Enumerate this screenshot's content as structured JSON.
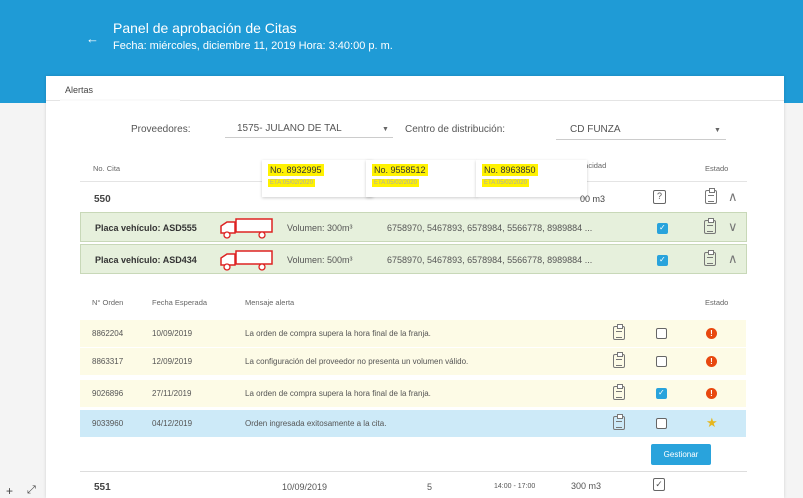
{
  "header": {
    "title": "Panel de aprobación de Citas",
    "subtitle": "Fecha: miércoles, diciembre 11, 2019 Hora: 3:40:00 p. m."
  },
  "tabs": {
    "alertas": "Alertas"
  },
  "filters": {
    "proveedores_label": "Proveedores:",
    "proveedores_value": "1575- JULANO DE TAL",
    "centro_label": "Centro de distribución:",
    "centro_value": "CD FUNZA"
  },
  "table": {
    "col_cita": "No. Cita",
    "col_capacidad": "pacidad",
    "col_estado": "Estado"
  },
  "notes": [
    {
      "number": "No. 8932995",
      "eta": "ETA:05/02/2020"
    },
    {
      "number": "No. 9558512",
      "eta": "ETA:05/02/2020"
    },
    {
      "number": "No. 8963850",
      "eta": "ETA:05/02/2020"
    }
  ],
  "cita1": {
    "id": "550",
    "capacidad": "00 m3"
  },
  "vehicles": [
    {
      "plate": "Placa vehículo: ASD555",
      "volume": "Volumen: 300m³",
      "orders": "6758970, 5467893, 6578984, 5566778, 8989884 ..."
    },
    {
      "plate": "Placa vehículo: ASD434",
      "volume": "Volumen: 500m³",
      "orders": "6758970, 5467893, 6578984, 5566778, 8989884 ..."
    }
  ],
  "alerts_head": {
    "orden": "N° Orden",
    "fecha": "Fecha Esperada",
    "mensaje": "Mensaje alerta",
    "estado": "Estado"
  },
  "alerts": [
    {
      "orden": "8862204",
      "fecha": "10/09/2019",
      "mensaje": "La orden de compra supera la hora final de la franja."
    },
    {
      "orden": "8863317",
      "fecha": "12/09/2019",
      "mensaje": "La configuración del proveedor no presenta un volumen válido."
    },
    {
      "orden": "9026896",
      "fecha": "27/11/2019",
      "mensaje": "La orden de compra supera la hora final de la franja."
    },
    {
      "orden": "9033960",
      "fecha": "04/12/2019",
      "mensaje": "Orden ingresada exitosamente a la cita."
    }
  ],
  "gestionar": "Gestionar",
  "cita2": {
    "id": "551",
    "fecha": "10/09/2019",
    "count": "5",
    "franja": "14:00 - 17:00",
    "capacidad": "300 m3"
  },
  "colors": {
    "header": "#1f9bd6",
    "green_row": "#e6f0dc",
    "yellow_row": "#fdfbe6",
    "blue_row": "#cdeaf8",
    "warn": "#e8480f",
    "accent": "#29a3dc"
  }
}
